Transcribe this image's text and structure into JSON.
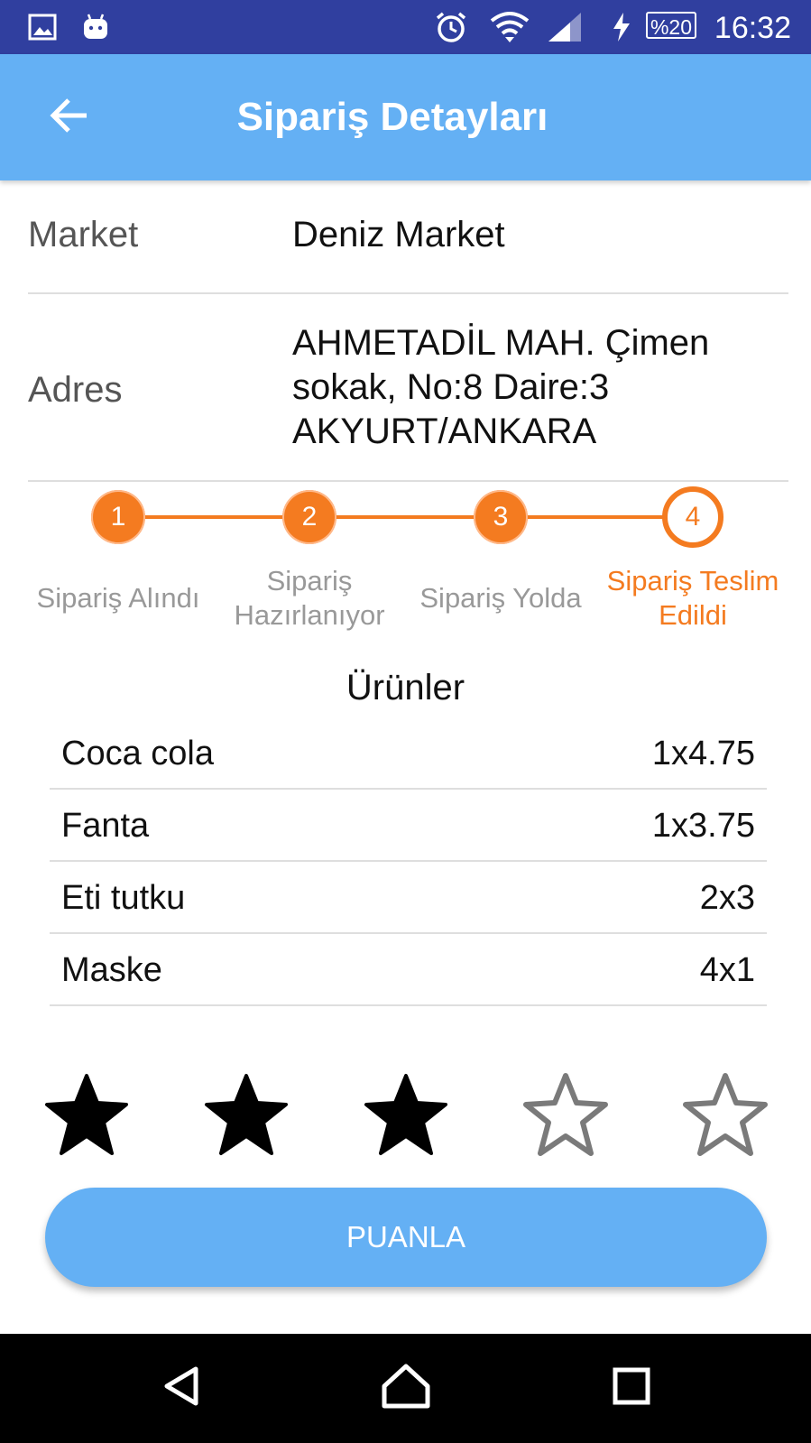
{
  "status_bar": {
    "time": "16:32",
    "battery": "%20",
    "icons": [
      "image-icon",
      "android-icon",
      "alarm-icon",
      "wifi-icon",
      "signal-icon",
      "charging-icon",
      "battery-icon"
    ]
  },
  "app_bar": {
    "title": "Sipariş Detayları",
    "back_icon": "arrow-left-icon"
  },
  "order": {
    "market_label": "Market",
    "market_value": "Deniz Market",
    "address_label": "Adres",
    "address_lines": [
      "AHMETADİL MAH. Çimen",
      "sokak, No:8 Daire:3",
      "AKYURT/ANKARA"
    ]
  },
  "stepper": {
    "steps": [
      {
        "number": "1",
        "label_lines": [
          "Sipariş Alındı"
        ]
      },
      {
        "number": "2",
        "label_lines": [
          "Sipariş",
          "Hazırlanıyor"
        ]
      },
      {
        "number": "3",
        "label_lines": [
          "Sipariş Yolda"
        ]
      },
      {
        "number": "4",
        "label_lines": [
          "Sipariş Teslim",
          "Edildi"
        ]
      }
    ],
    "current_step": 4,
    "active_color": "#f47b20"
  },
  "products": {
    "title": "Ürünler",
    "items": [
      {
        "name": "Coca cola",
        "qty": "1x4.75"
      },
      {
        "name": "Fanta",
        "qty": "1x3.75"
      },
      {
        "name": "Eti tutku",
        "qty": "2x3"
      },
      {
        "name": "Maske",
        "qty": "4x1"
      }
    ]
  },
  "rating": {
    "value": 3,
    "max": 5
  },
  "rate_button": {
    "label": "PUANLA"
  },
  "nav_bar": {
    "icons": [
      "back-triangle-icon",
      "home-icon",
      "recents-square-icon"
    ]
  },
  "colors": {
    "status_bar": "#303f9f",
    "app_bar": "#64b0f4",
    "accent": "#f47b20"
  }
}
